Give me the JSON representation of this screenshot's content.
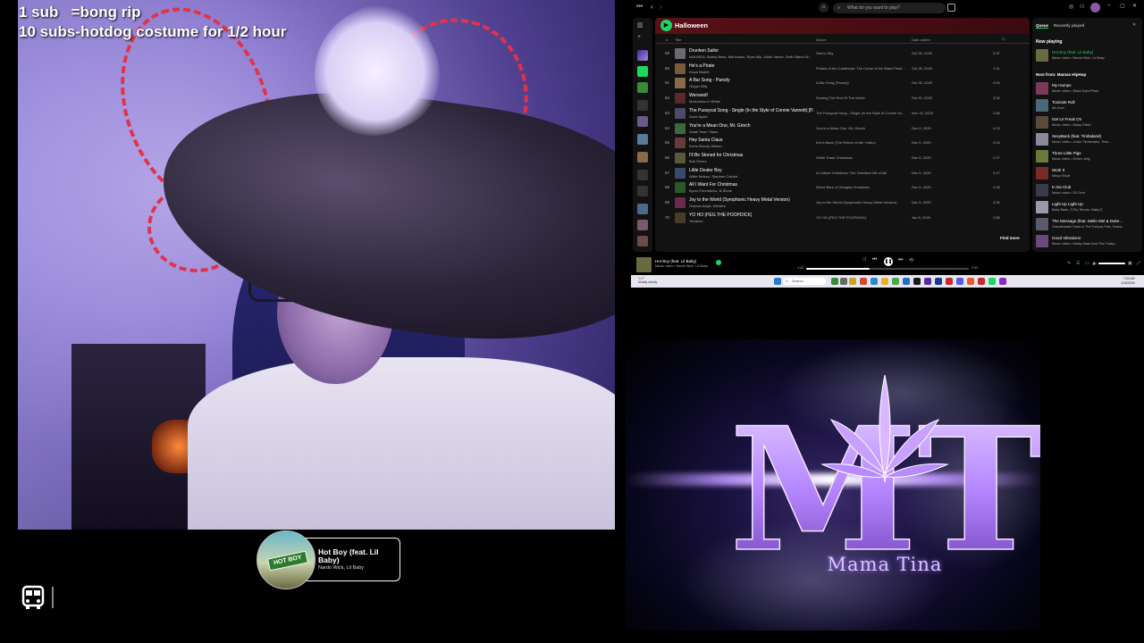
{
  "overlay": {
    "line1": "1 sub   =bong rip",
    "line2": "10 subs-hotdog costume for 1/2 hour"
  },
  "now_playing_widget": {
    "title": "Hot Boy (feat. Lil Baby)",
    "artist": "Nardo Wick, Lil Baby",
    "art_sign": "HOT BOY"
  },
  "spotify": {
    "search_placeholder": "What do you want to play?",
    "playlist_title": "Halloween",
    "columns": {
      "num": "#",
      "title": "Title",
      "album": "Album",
      "date_added": "Date added"
    },
    "rows": [
      {
        "num": "59",
        "title": "Drunken Sailor",
        "artist": "MALINDA, Bobby Bass, Mia Asano, Ryan Ally, Julian Vance, Seth Staton W...",
        "album": "Sea to Sky",
        "date": "Oct 26, 2025",
        "duration": "2:37",
        "color": "#6a6a70"
      },
      {
        "num": "60",
        "title": "He's a Pirate",
        "artist": "Klaus Badelt",
        "album": "Pirates of the Caribbean: The Curse of the Black Pearl...",
        "date": "Oct 26, 2025",
        "duration": "1:31",
        "color": "#7a5a3a"
      },
      {
        "num": "61",
        "title": "A Bar Song - Parody",
        "artist": "Ginger Billy",
        "album": "A Bar Song (Parody)",
        "date": "Oct 26, 2025",
        "duration": "2:54",
        "color": "#8a6a4a"
      },
      {
        "num": "62",
        "title": "Werewolf",
        "artist": "Motionless In White",
        "album": "Scoring The End Of The World",
        "date": "Oct 20, 2025",
        "duration": "3:32",
        "color": "#5a2a2a"
      },
      {
        "num": "63",
        "title": "The Pussycat Song - Single (In the Style of Connie Vannett) [P...",
        "artist": "Done Again",
        "album": "The Pussycat Song - Single (In the Style of Connie Va...",
        "date": "Nov 15, 2025",
        "duration": "2:46",
        "color": "#4a4a6a"
      },
      {
        "num": "64",
        "title": "You're a Mean One, Mr. Grinch",
        "artist": "Small Town Titans",
        "album": "You're a Mean One, Mr. Grinch",
        "date": "Dec 5, 2025",
        "duration": "4:13",
        "color": "#3a6a3a"
      },
      {
        "num": "65",
        "title": "Hey Santa Claus",
        "artist": "Kevin Bloody Wilson",
        "album": "Kev's Back (The Return of the Yobbo)",
        "date": "Dec 5, 2025",
        "duration": "3:15",
        "color": "#6a3a3a"
      },
      {
        "num": "66",
        "title": "I'll Be Stoned for Christmas",
        "artist": "Bob Rivers",
        "album": "White Trash Christmas",
        "date": "Dec 5, 2025",
        "duration": "2:27",
        "color": "#5a5a3a"
      },
      {
        "num": "67",
        "title": "Little Dealer Boy",
        "artist": "Willie Nelson, Stephen Colbert",
        "album": "A Colbert Christmas: The Greatest Gift of All!",
        "date": "Dec 5, 2025",
        "duration": "2:17",
        "color": "#3a4a6a"
      },
      {
        "num": "68",
        "title": "All I Want For Christmas",
        "artist": "Byron Ferendinks, B-Stone",
        "album": "Weed Bars: A Gangsta Christmas",
        "date": "Dec 5, 2025",
        "duration": "2:06",
        "color": "#2a5a2a"
      },
      {
        "num": "69",
        "title": "Joy to the World (Symphonic Heavy Metal Version)",
        "artist": "Octavia Aegis, Minidea",
        "album": "Joy to the World (Symphonic Heavy Metal Version)",
        "date": "Dec 5, 2025",
        "duration": "3:30",
        "color": "#6a2a4a"
      },
      {
        "num": "70",
        "title": "YO HO (PEG THE POOPDICK)",
        "artist": "Yeedeon",
        "album": "YO HO (PEG THE POOPDICK)",
        "date": "Jan 8, 2026",
        "duration": "2:56",
        "color": "#4a3a2a"
      }
    ],
    "find_more": "Find more",
    "queue": {
      "tab_queue": "Queue",
      "tab_recent": "Recently played",
      "now_playing_label": "Now playing",
      "now_playing": {
        "title": "Hot Boy (feat. Lil Baby)",
        "sub": "Music video • Nardo Wick, Lil Baby",
        "color": "#6a6a40"
      },
      "next_label": "Next from: Mamas HipHop",
      "items": [
        {
          "title": "My Humps",
          "sub": "Music video • Black Eyed Peas",
          "color": "#7a3a5a"
        },
        {
          "title": "Toxicate Roll",
          "sub": "Ab-Soul",
          "color": "#4a6a7a"
        },
        {
          "title": "Get Ur Freak On",
          "sub": "Music video • Missy Elliott",
          "color": "#5a4a3a"
        },
        {
          "title": "SexyBack (feat. Timbaland)",
          "sub": "Music video • Justin Timberlake, Timb...",
          "color": "#8a8a9a"
        },
        {
          "title": "Three Little Pigs",
          "sub": "Music video • Green Jelly",
          "color": "#6a7a3a"
        },
        {
          "title": "Work It",
          "sub": "Missy Elliott",
          "color": "#7a2a2a"
        },
        {
          "title": "In Da Club",
          "sub": "Music video • 50 Cent",
          "color": "#3a3a4a"
        },
        {
          "title": "Light Up Light Up",
          "sub": "Baby Bash, Z-Ro, Berner, Baby E",
          "color": "#9a9aaa"
        },
        {
          "title": "The Message (feat. Melle Mel & Duke...",
          "sub": "Grandmaster Flash & The Furious Five, Grand...",
          "color": "#5a5a6a"
        },
        {
          "title": "Good Vibrations",
          "sub": "Music video • Marky Mark And The Funky...",
          "color": "#6a4a7a"
        }
      ]
    },
    "player": {
      "title": "Hot Boy (feat. Lil Baby)",
      "artist": "Music video • Nardo Wick, Lil Baby",
      "elapsed": "1:05",
      "total": "2:49",
      "progress": 0.39
    }
  },
  "taskbar": {
    "weather_temp": "34°F",
    "weather_desc": "Mostly cloudy",
    "search": "Search",
    "time": "7:53 AM",
    "date": "1/18/2026"
  },
  "logo": {
    "monogram": "MT",
    "name": "Mama Tina"
  },
  "colors": {
    "spotify_green": "#1ed760",
    "logo_purple": "#b586ff"
  }
}
